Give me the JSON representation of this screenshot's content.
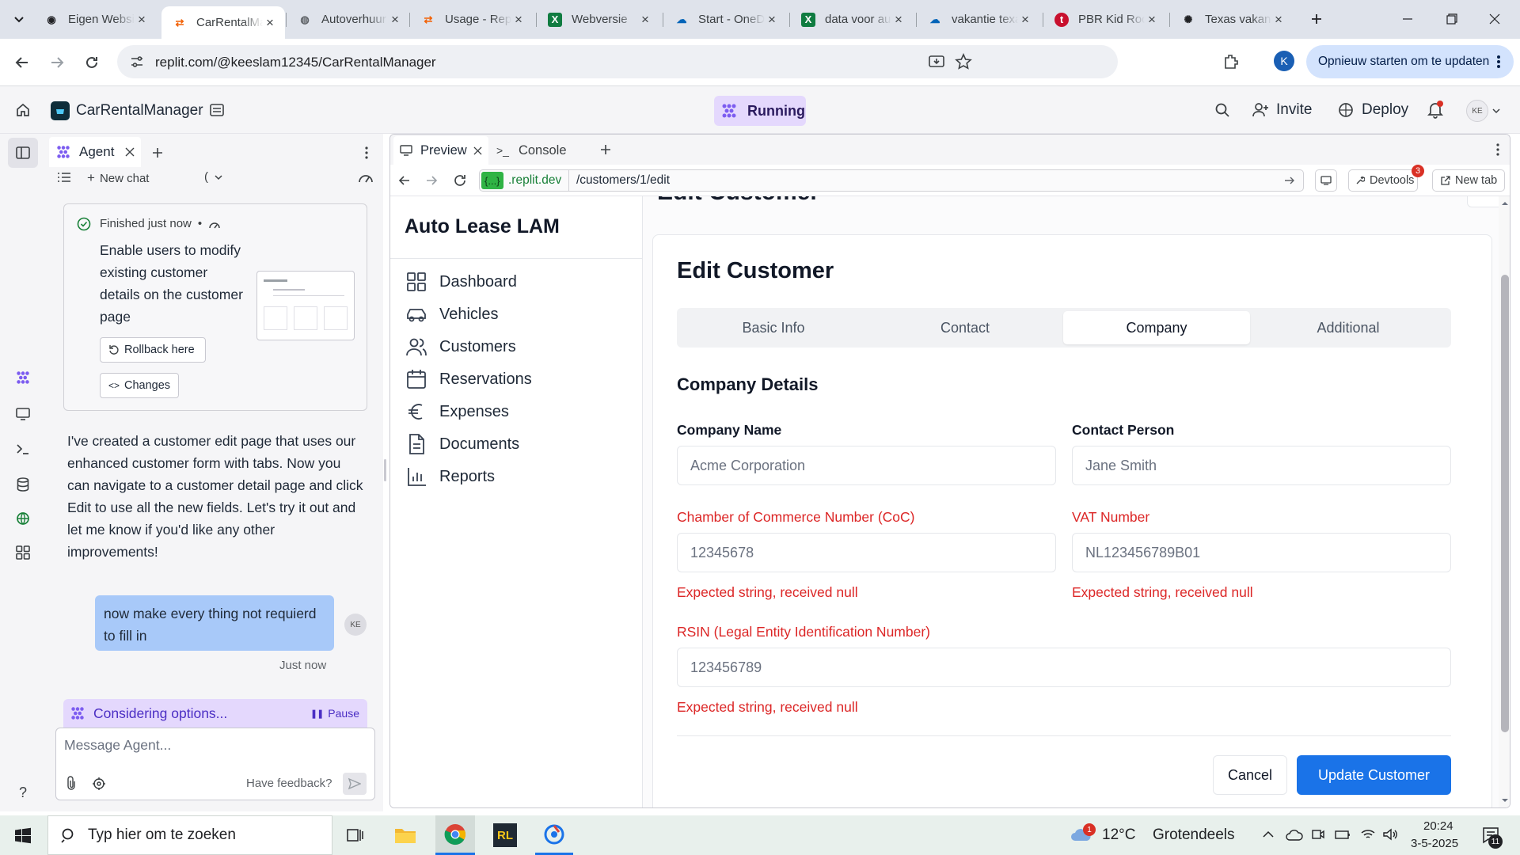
{
  "browser": {
    "tabs": [
      {
        "title": "Eigen Website",
        "icon": "eye-icon",
        "color": "#202124"
      },
      {
        "title": "CarRentalManager",
        "icon": "replit-icon",
        "color": "#f26207"
      },
      {
        "title": "Autoverhuur",
        "icon": "globe-icon",
        "color": "#5f6368"
      },
      {
        "title": "Usage - Replit",
        "icon": "replit-icon",
        "color": "#f26207"
      },
      {
        "title": "Webversie",
        "icon": "excel-icon",
        "color": "#107c41"
      },
      {
        "title": "Start - OneDrive",
        "icon": "onedrive-icon",
        "color": "#0364b8"
      },
      {
        "title": "data voor auto",
        "icon": "excel-icon",
        "color": "#107c41"
      },
      {
        "title": "vakantie texas",
        "icon": "onedrive-icon",
        "color": "#0364b8"
      },
      {
        "title": "PBR Kid Rock",
        "icon": "pbr-icon",
        "color": "#c8102e"
      },
      {
        "title": "Texas vakantie",
        "icon": "chatgpt-icon",
        "color": "#202124"
      }
    ],
    "url": "replit.com/@keeslam12345/CarRentalManager",
    "restart_label": "Opnieuw starten om te updaten",
    "profile_initial": "K"
  },
  "replit": {
    "project_name": "CarRentalManager",
    "status": "Running",
    "invite_label": "Invite",
    "deploy_label": "Deploy",
    "avatar_initials": "KE"
  },
  "agent": {
    "tab_label": "Agent",
    "new_chat_label": "New chat",
    "history_glyph": "(",
    "finished_label": "Finished just now",
    "finished_bullet": "•",
    "task_text": "Enable users to modify existing customer details on the customer page",
    "rollback_label": "Rollback here",
    "changes_label": "Changes",
    "message": "I've created a customer edit page that uses our enhanced customer form with tabs. Now you can navigate to a customer detail page and click Edit to use all the new fields. Let's try it out and let me know if you'd like any other improvements!",
    "user_message": "now make every thing not requierd to fill in",
    "user_initials": "KE",
    "user_time": "Just now",
    "status_text": "Considering options...",
    "pause_label": "Pause",
    "input_placeholder": "Message Agent...",
    "feedback_label": "Have feedback?"
  },
  "preview": {
    "tabs": [
      {
        "label": "Preview"
      },
      {
        "label": "Console"
      }
    ],
    "domain_badge": "{...}",
    "domain": ".replit.dev",
    "path": "/customers/1/edit",
    "devtools_label": "Devtools",
    "devtools_badge": "3",
    "newtab_label": "New tab"
  },
  "app": {
    "brand": "Auto Lease LAM",
    "nav": [
      {
        "label": "Dashboard",
        "icon": "dashboard-icon"
      },
      {
        "label": "Vehicles",
        "icon": "car-icon"
      },
      {
        "label": "Customers",
        "icon": "users-icon"
      },
      {
        "label": "Reservations",
        "icon": "calendar-icon"
      },
      {
        "label": "Expenses",
        "icon": "euro-icon"
      },
      {
        "label": "Documents",
        "icon": "document-icon"
      },
      {
        "label": "Reports",
        "icon": "chart-icon"
      }
    ],
    "bg_heading": "Edit Customer",
    "form": {
      "title": "Edit Customer",
      "tabs": [
        "Basic Info",
        "Contact",
        "Company",
        "Additional"
      ],
      "active_tab": "Company",
      "section_title": "Company Details",
      "company_name_label": "Company Name",
      "company_name_placeholder": "Acme Corporation",
      "contact_person_label": "Contact Person",
      "contact_person_placeholder": "Jane Smith",
      "coc_label": "Chamber of Commerce Number (CoC)",
      "coc_placeholder": "12345678",
      "vat_label": "VAT Number",
      "vat_placeholder": "NL123456789B01",
      "rsin_label": "RSIN (Legal Entity Identification Number)",
      "rsin_placeholder": "123456789",
      "error_text": "Expected string, received null",
      "cancel_label": "Cancel",
      "submit_label": "Update Customer"
    }
  },
  "taskbar": {
    "search_placeholder": "Typ hier om te zoeken",
    "weather_temp": "12°C",
    "weather_text": "Grotendeels bewolkt",
    "weather_badge": "1",
    "time": "20:24",
    "date": "3-5-2025",
    "notif_count": "11",
    "app_rl": "RL"
  },
  "colors": {
    "accent_blue": "#1a73e8",
    "error_red": "#dc2626",
    "running_purple": "#e4d8fd",
    "agent_bubble": "#a8c9f9"
  }
}
